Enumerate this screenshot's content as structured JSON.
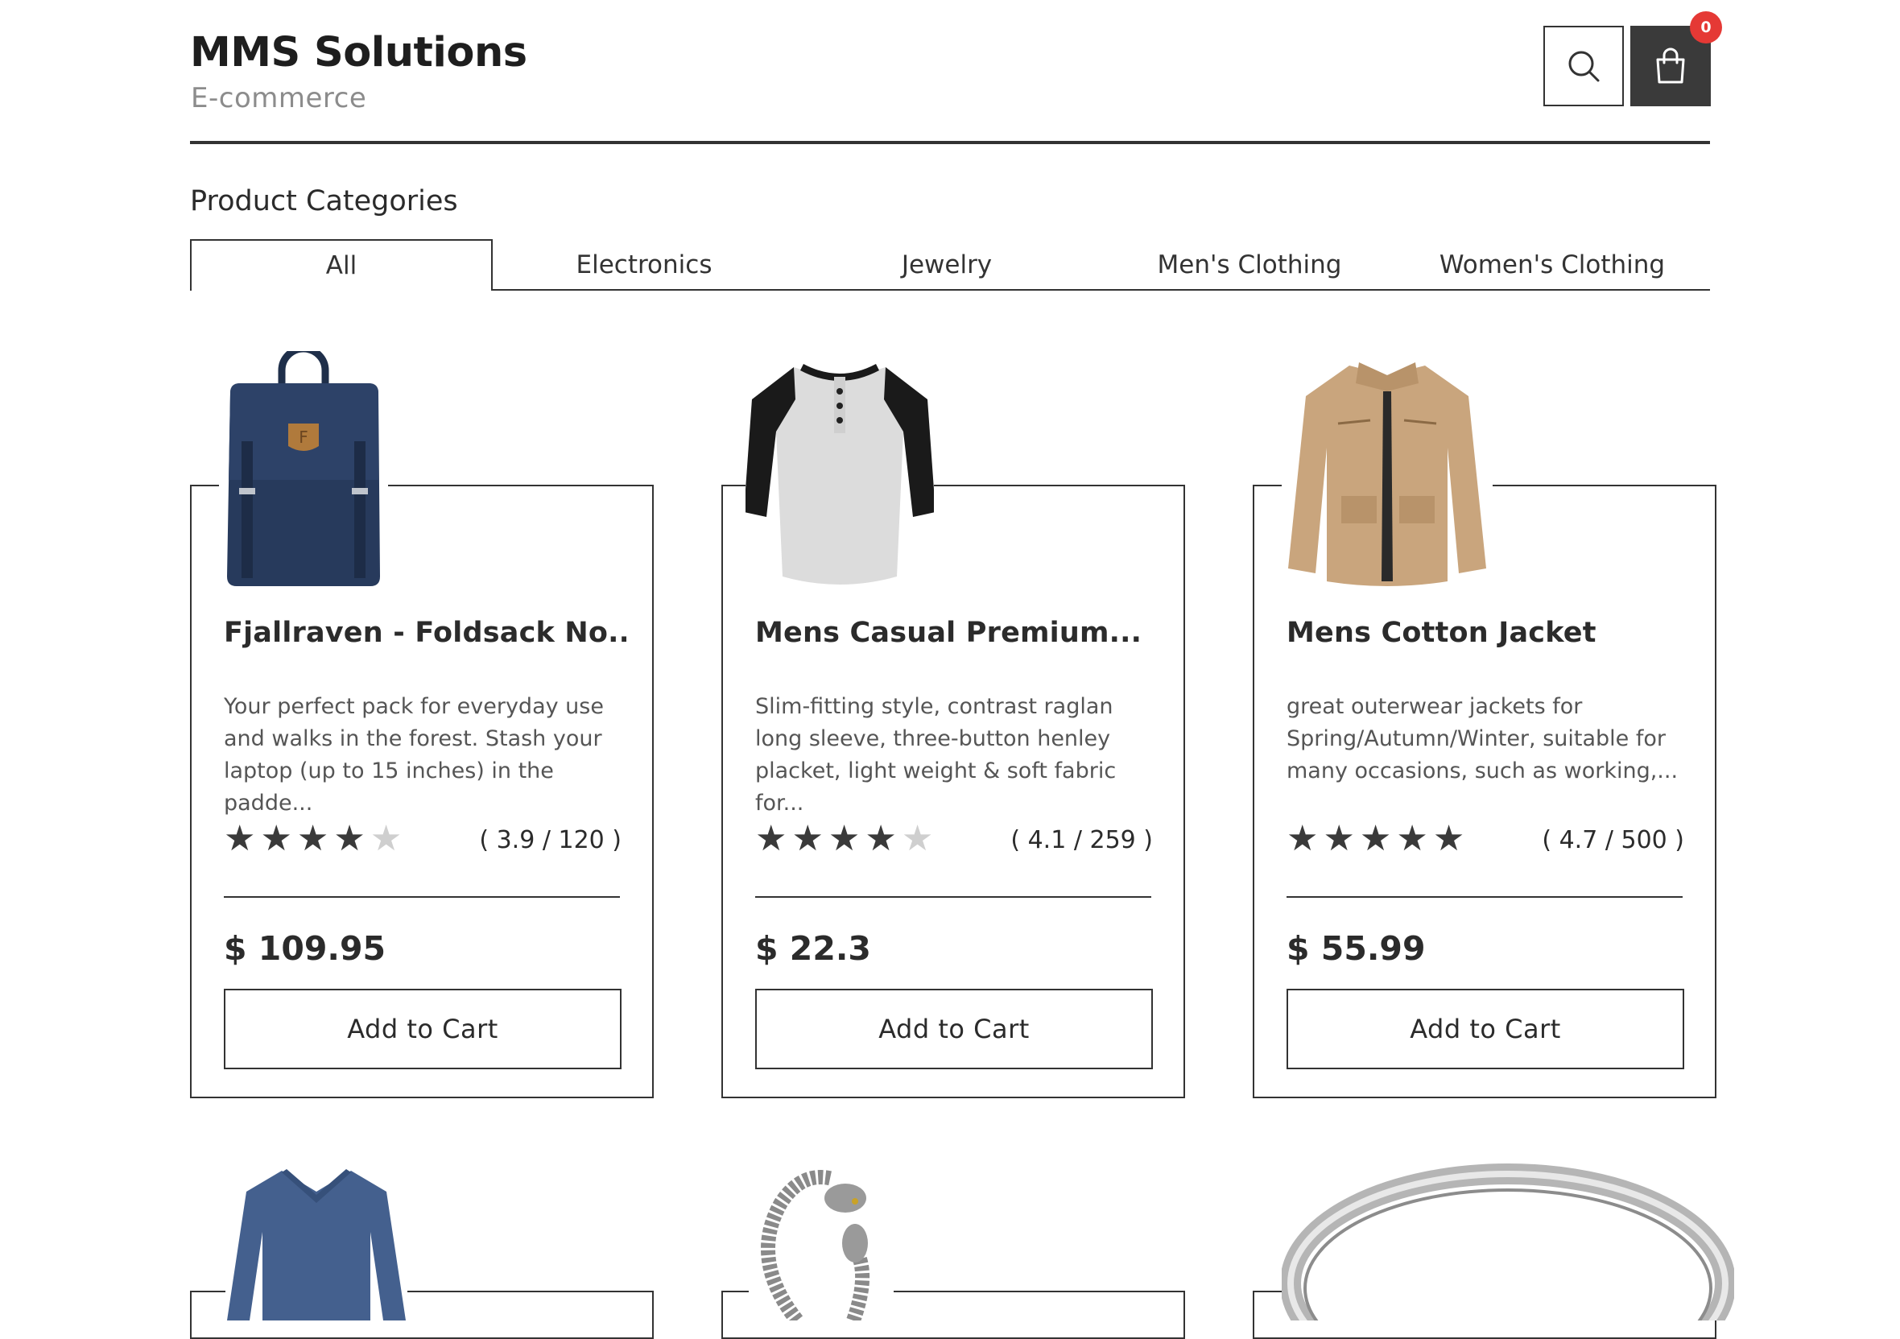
{
  "header": {
    "brand_title": "MMS Solutions",
    "brand_subtitle": "E-commerce",
    "cart_count": "0",
    "icons": {
      "search": "search-icon",
      "cart": "shopping-bag-icon"
    },
    "colors": {
      "accent": "#3a3a3a",
      "badge": "#e53935"
    }
  },
  "categories": {
    "heading": "Product Categories",
    "tabs": [
      {
        "label": "All",
        "active": true
      },
      {
        "label": "Electronics",
        "active": false
      },
      {
        "label": "Jewelry",
        "active": false
      },
      {
        "label": "Men's Clothing",
        "active": false
      },
      {
        "label": "Women's Clothing",
        "active": false
      }
    ]
  },
  "products": [
    {
      "title": "Fjallraven - Foldsack No....",
      "description": [
        "Your perfect pack for everyday use",
        "and walks in the forest. Stash your",
        "laptop (up to 15 inches) in the padde..."
      ],
      "rating": 3.9,
      "filled_stars": 4,
      "rating_text": "( 3.9 / 120 )",
      "price": "$ 109.95",
      "button": "Add to Cart",
      "image": "navy-backpack"
    },
    {
      "title": "Mens Casual Premium...",
      "description": [
        "Slim-fitting style, contrast raglan",
        "long sleeve, three-button henley",
        "placket, light weight & soft fabric for..."
      ],
      "rating": 4.1,
      "filled_stars": 4,
      "rating_text": "( 4.1 / 259 )",
      "price": "$ 22.3",
      "button": "Add to Cart",
      "image": "raglan-henley-shirt"
    },
    {
      "title": "Mens Cotton Jacket",
      "description": [
        "great outerwear jackets for",
        "Spring/Autumn/Winter, suitable for",
        "many occasions, such as working,..."
      ],
      "rating": 4.7,
      "filled_stars": 5,
      "rating_text": "( 4.7 / 500 )",
      "price": "$ 55.99",
      "button": "Add to Cart",
      "image": "tan-cotton-jacket"
    },
    {
      "image": "blue-vneck-sweater"
    },
    {
      "image": "dragon-chain-bracelet"
    },
    {
      "image": "silver-bangle-ring"
    }
  ]
}
